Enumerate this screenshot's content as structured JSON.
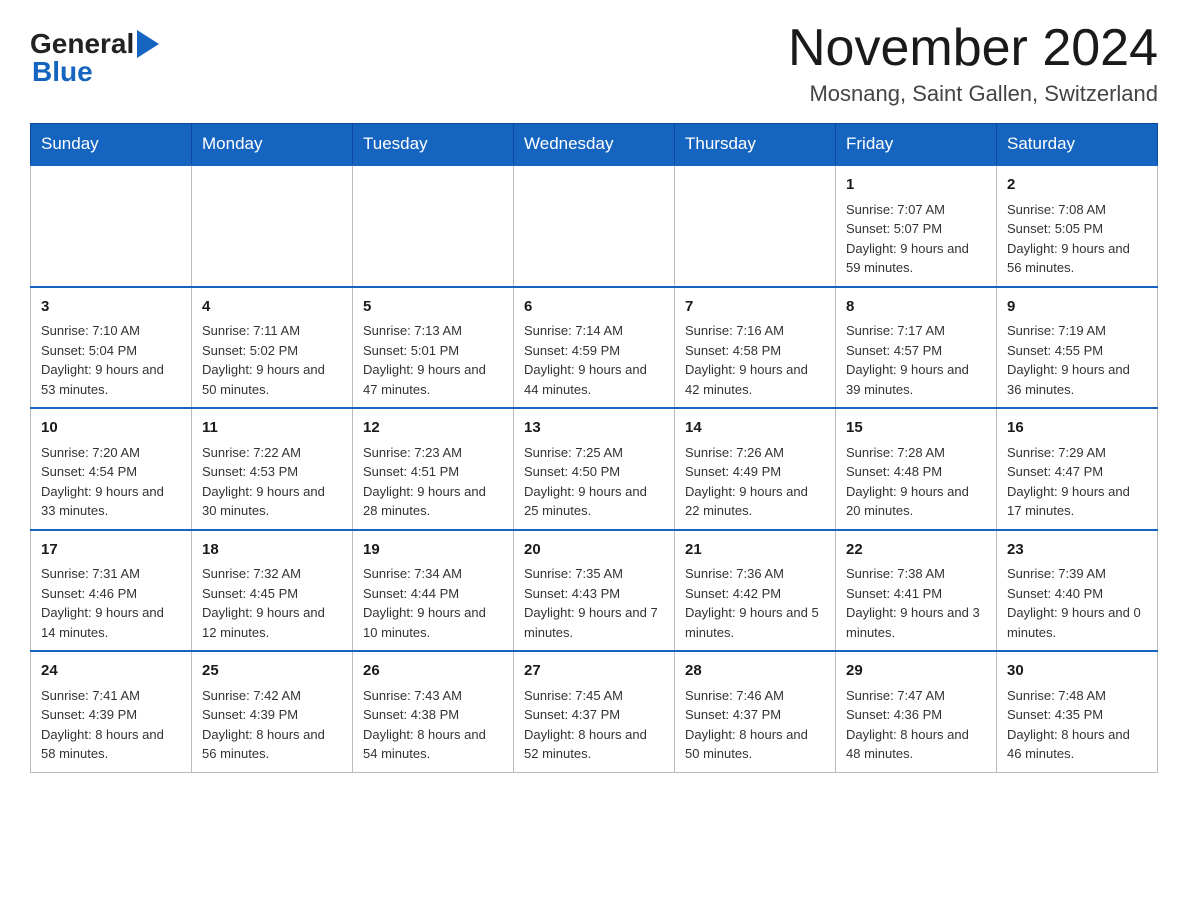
{
  "header": {
    "logo_general": "General",
    "logo_blue": "Blue",
    "month_title": "November 2024",
    "location": "Mosnang, Saint Gallen, Switzerland"
  },
  "weekdays": [
    "Sunday",
    "Monday",
    "Tuesday",
    "Wednesday",
    "Thursday",
    "Friday",
    "Saturday"
  ],
  "weeks": [
    [
      {
        "day": "",
        "info": ""
      },
      {
        "day": "",
        "info": ""
      },
      {
        "day": "",
        "info": ""
      },
      {
        "day": "",
        "info": ""
      },
      {
        "day": "",
        "info": ""
      },
      {
        "day": "1",
        "info": "Sunrise: 7:07 AM\nSunset: 5:07 PM\nDaylight: 9 hours and 59 minutes."
      },
      {
        "day": "2",
        "info": "Sunrise: 7:08 AM\nSunset: 5:05 PM\nDaylight: 9 hours and 56 minutes."
      }
    ],
    [
      {
        "day": "3",
        "info": "Sunrise: 7:10 AM\nSunset: 5:04 PM\nDaylight: 9 hours and 53 minutes."
      },
      {
        "day": "4",
        "info": "Sunrise: 7:11 AM\nSunset: 5:02 PM\nDaylight: 9 hours and 50 minutes."
      },
      {
        "day": "5",
        "info": "Sunrise: 7:13 AM\nSunset: 5:01 PM\nDaylight: 9 hours and 47 minutes."
      },
      {
        "day": "6",
        "info": "Sunrise: 7:14 AM\nSunset: 4:59 PM\nDaylight: 9 hours and 44 minutes."
      },
      {
        "day": "7",
        "info": "Sunrise: 7:16 AM\nSunset: 4:58 PM\nDaylight: 9 hours and 42 minutes."
      },
      {
        "day": "8",
        "info": "Sunrise: 7:17 AM\nSunset: 4:57 PM\nDaylight: 9 hours and 39 minutes."
      },
      {
        "day": "9",
        "info": "Sunrise: 7:19 AM\nSunset: 4:55 PM\nDaylight: 9 hours and 36 minutes."
      }
    ],
    [
      {
        "day": "10",
        "info": "Sunrise: 7:20 AM\nSunset: 4:54 PM\nDaylight: 9 hours and 33 minutes."
      },
      {
        "day": "11",
        "info": "Sunrise: 7:22 AM\nSunset: 4:53 PM\nDaylight: 9 hours and 30 minutes."
      },
      {
        "day": "12",
        "info": "Sunrise: 7:23 AM\nSunset: 4:51 PM\nDaylight: 9 hours and 28 minutes."
      },
      {
        "day": "13",
        "info": "Sunrise: 7:25 AM\nSunset: 4:50 PM\nDaylight: 9 hours and 25 minutes."
      },
      {
        "day": "14",
        "info": "Sunrise: 7:26 AM\nSunset: 4:49 PM\nDaylight: 9 hours and 22 minutes."
      },
      {
        "day": "15",
        "info": "Sunrise: 7:28 AM\nSunset: 4:48 PM\nDaylight: 9 hours and 20 minutes."
      },
      {
        "day": "16",
        "info": "Sunrise: 7:29 AM\nSunset: 4:47 PM\nDaylight: 9 hours and 17 minutes."
      }
    ],
    [
      {
        "day": "17",
        "info": "Sunrise: 7:31 AM\nSunset: 4:46 PM\nDaylight: 9 hours and 14 minutes."
      },
      {
        "day": "18",
        "info": "Sunrise: 7:32 AM\nSunset: 4:45 PM\nDaylight: 9 hours and 12 minutes."
      },
      {
        "day": "19",
        "info": "Sunrise: 7:34 AM\nSunset: 4:44 PM\nDaylight: 9 hours and 10 minutes."
      },
      {
        "day": "20",
        "info": "Sunrise: 7:35 AM\nSunset: 4:43 PM\nDaylight: 9 hours and 7 minutes."
      },
      {
        "day": "21",
        "info": "Sunrise: 7:36 AM\nSunset: 4:42 PM\nDaylight: 9 hours and 5 minutes."
      },
      {
        "day": "22",
        "info": "Sunrise: 7:38 AM\nSunset: 4:41 PM\nDaylight: 9 hours and 3 minutes."
      },
      {
        "day": "23",
        "info": "Sunrise: 7:39 AM\nSunset: 4:40 PM\nDaylight: 9 hours and 0 minutes."
      }
    ],
    [
      {
        "day": "24",
        "info": "Sunrise: 7:41 AM\nSunset: 4:39 PM\nDaylight: 8 hours and 58 minutes."
      },
      {
        "day": "25",
        "info": "Sunrise: 7:42 AM\nSunset: 4:39 PM\nDaylight: 8 hours and 56 minutes."
      },
      {
        "day": "26",
        "info": "Sunrise: 7:43 AM\nSunset: 4:38 PM\nDaylight: 8 hours and 54 minutes."
      },
      {
        "day": "27",
        "info": "Sunrise: 7:45 AM\nSunset: 4:37 PM\nDaylight: 8 hours and 52 minutes."
      },
      {
        "day": "28",
        "info": "Sunrise: 7:46 AM\nSunset: 4:37 PM\nDaylight: 8 hours and 50 minutes."
      },
      {
        "day": "29",
        "info": "Sunrise: 7:47 AM\nSunset: 4:36 PM\nDaylight: 8 hours and 48 minutes."
      },
      {
        "day": "30",
        "info": "Sunrise: 7:48 AM\nSunset: 4:35 PM\nDaylight: 8 hours and 46 minutes."
      }
    ]
  ]
}
